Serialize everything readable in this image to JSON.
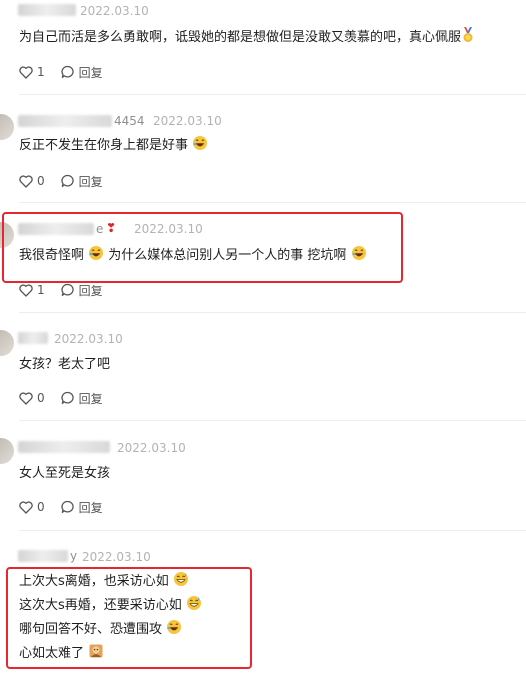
{
  "comments": [
    {
      "name_tail": "",
      "date": "2022.03.10",
      "text": "为自己而活是多么勇敢啊，诋毁她的都是想做但是没敢又羡慕的吧，真心佩服",
      "text_suffix_emoji": "medal",
      "likes": "1",
      "reply_label": "回复"
    },
    {
      "name_tail": "4454",
      "date": "2022.03.10",
      "text": "反正不发生在你身上都是好事",
      "text_suffix_emoji": "laugh",
      "likes": "0",
      "reply_label": "回复"
    },
    {
      "name_tail": "e",
      "date": "2022.03.10",
      "text_parts": [
        "我很奇怪啊",
        "为什么媒体总问别人另一个人的事 挖坑啊"
      ],
      "likes": "1",
      "reply_label": "回复"
    },
    {
      "name_tail": "",
      "date": "2022.03.10",
      "text": "女孩？老太了吧",
      "likes": "0",
      "reply_label": "回复"
    },
    {
      "name_tail": "",
      "date": "2022.03.10",
      "text": "女人至死是女孩",
      "likes": "0",
      "reply_label": "回复"
    },
    {
      "name_tail": "y",
      "date": "2022.03.10",
      "lines": [
        "上次大s离婚，也采访心如",
        "这次大s再婚，还要采访心如",
        "哪句回答不好、恐遭围攻",
        "心如太难了"
      ]
    }
  ],
  "colors": {
    "highlight": "#e8262f",
    "date": "#b3b3b3",
    "text": "#1e1e1e"
  },
  "icons": {
    "like": "heart-outline-icon",
    "reply": "speech-bubble-icon"
  }
}
